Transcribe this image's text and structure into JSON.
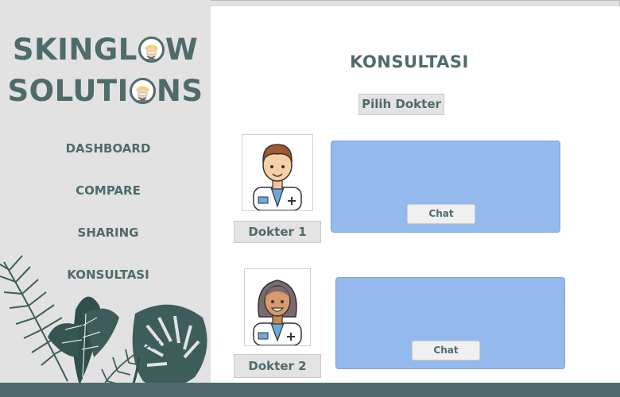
{
  "brand": {
    "line1_before": "SKINGL",
    "line1_after": "W",
    "line2_before": "SOLUTI",
    "line2_after": "NS",
    "logo_icon": "face-mask-icon"
  },
  "nav": {
    "items": [
      {
        "label": "DASHBOARD"
      },
      {
        "label": "COMPARE"
      },
      {
        "label": "SHARING"
      },
      {
        "label": "KONSULTASI"
      }
    ]
  },
  "main": {
    "title": "KONSULTASI",
    "pilih_label": "Pilih Dokter"
  },
  "doctors": [
    {
      "label": "Dokter 1",
      "chat_label": "Chat",
      "avatar_icon": "male-doctor-icon"
    },
    {
      "label": "Dokter 2",
      "chat_label": "Chat",
      "avatar_icon": "female-doctor-icon"
    }
  ],
  "colors": {
    "accent": "#4f6b6b",
    "chat_card": "#94b9ec",
    "sidebar_bg": "#e2e2e2"
  }
}
